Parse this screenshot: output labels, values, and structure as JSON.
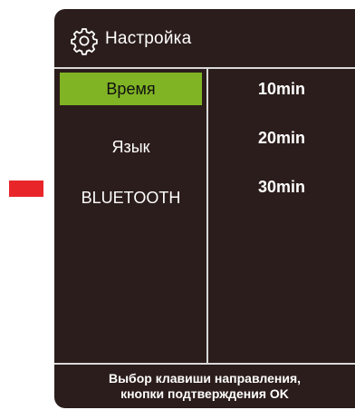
{
  "header": {
    "icon": "gear-icon",
    "title": "Настройка"
  },
  "menu": {
    "items": [
      {
        "label": "Время",
        "selected": true
      },
      {
        "label": "Язык",
        "selected": false
      },
      {
        "label": "BLUETOOTH",
        "selected": false
      }
    ]
  },
  "options": {
    "items": [
      {
        "label": "10min"
      },
      {
        "label": "20min"
      },
      {
        "label": "30min"
      }
    ]
  },
  "footer": {
    "line1": "Выбор клавиши направления,",
    "line2": "кнопки подтверждения OK"
  },
  "colors": {
    "panel_bg": "#2b1d1b",
    "selection": "#80b424",
    "indicator": "#e8262a",
    "divider": "#d9d9d9"
  }
}
